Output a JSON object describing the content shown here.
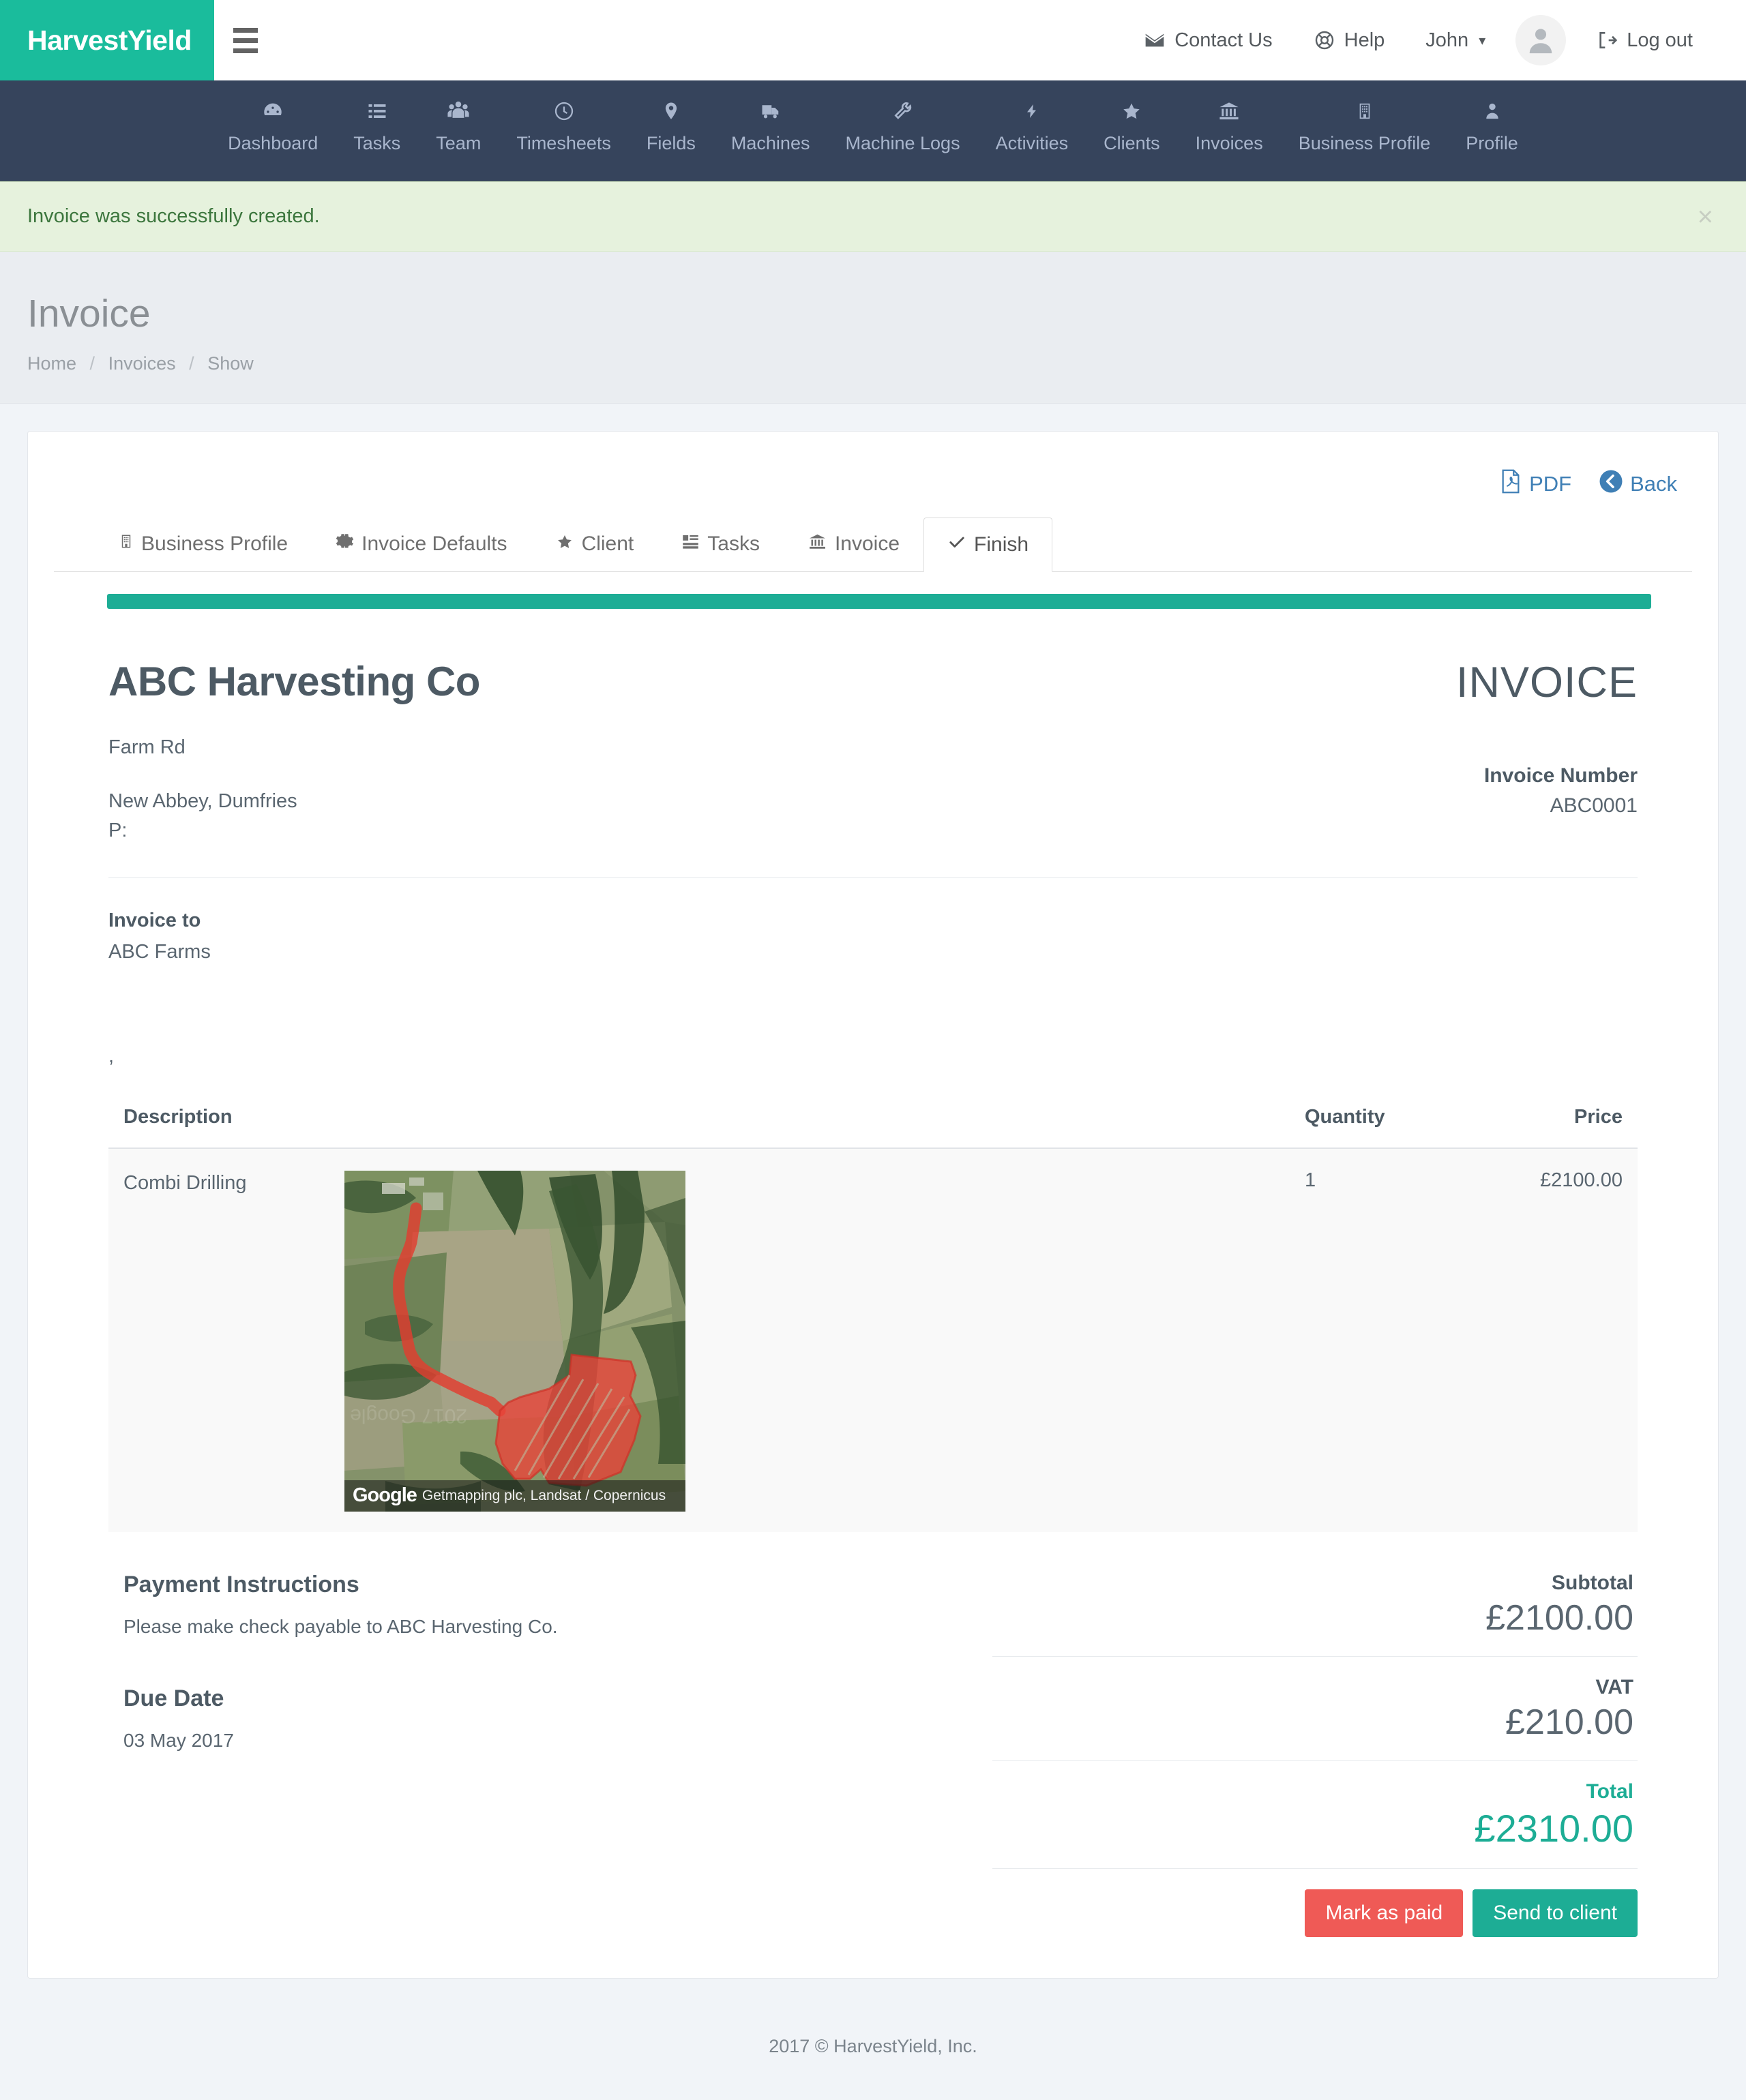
{
  "brand": {
    "name": "HarvestYield"
  },
  "topbar": {
    "contact": "Contact Us",
    "help": "Help",
    "user": "John",
    "logout": "Log out"
  },
  "nav": {
    "items": [
      {
        "label": "Dashboard",
        "icon": "dashboard-icon"
      },
      {
        "label": "Tasks",
        "icon": "list-icon"
      },
      {
        "label": "Team",
        "icon": "users-icon"
      },
      {
        "label": "Timesheets",
        "icon": "clock-icon"
      },
      {
        "label": "Fields",
        "icon": "map-pin-icon"
      },
      {
        "label": "Machines",
        "icon": "truck-icon"
      },
      {
        "label": "Machine Logs",
        "icon": "wrench-icon"
      },
      {
        "label": "Activities",
        "icon": "bolt-icon"
      },
      {
        "label": "Clients",
        "icon": "star-icon"
      },
      {
        "label": "Invoices",
        "icon": "bank-icon"
      },
      {
        "label": "Business Profile",
        "icon": "building-icon"
      },
      {
        "label": "Profile",
        "icon": "person-icon"
      }
    ]
  },
  "alert": {
    "message": "Invoice was successfully created.",
    "close": "×"
  },
  "page": {
    "title": "Invoice",
    "breadcrumb": [
      "Home",
      "Invoices",
      "Show"
    ]
  },
  "card_actions": {
    "pdf": "PDF",
    "back": "Back"
  },
  "tabs": [
    {
      "label": "Business Profile",
      "icon": "building-icon",
      "active": false
    },
    {
      "label": "Invoice Defaults",
      "icon": "gear-icon",
      "active": false
    },
    {
      "label": "Client",
      "icon": "star-icon",
      "active": false
    },
    {
      "label": "Tasks",
      "icon": "server-icon",
      "active": false
    },
    {
      "label": "Invoice",
      "icon": "bank-icon",
      "active": false
    },
    {
      "label": "Finish",
      "icon": "check-icon",
      "active": true
    }
  ],
  "invoice": {
    "business_name": "ABC Harvesting Co",
    "address_line1": "Farm Rd",
    "address_line2": "New Abbey, Dumfries",
    "phone": "P:",
    "heading": "INVOICE",
    "number_label": "Invoice Number",
    "number": "ABC0001",
    "invoice_to_label": "Invoice to",
    "invoice_to_name": "ABC Farms",
    "invoice_to_address": ",",
    "table": {
      "headers": {
        "description": "Description",
        "quantity": "Quantity",
        "price": "Price"
      },
      "rows": [
        {
          "description": "Combi Drilling",
          "quantity": "1",
          "price": "£2100.00",
          "has_map": true
        }
      ]
    },
    "map_attribution": {
      "logo": "Google",
      "text": "Getmapping plc, Landsat / Copernicus"
    },
    "payment_title": "Payment Instructions",
    "payment_text": "Please make check payable to ABC Harvesting Co.",
    "due_title": "Due Date",
    "due_date": "03 May 2017",
    "totals": [
      {
        "label": "Subtotal",
        "value": "£2100.00",
        "grand": false
      },
      {
        "label": "VAT",
        "value": "£210.00",
        "grand": false
      },
      {
        "label": "Total",
        "value": "£2310.00",
        "grand": true
      }
    ],
    "buttons": {
      "mark_paid": "Mark as paid",
      "send_client": "Send to client"
    }
  },
  "footer": {
    "text": "2017 © HarvestYield, Inc."
  },
  "colors": {
    "brand_green": "#1abc9c",
    "total_green": "#1dad95",
    "navy": "#36445c",
    "danger_red": "#ef5a56",
    "link_blue": "#3f7fb5",
    "alert_green_text": "#3c763d"
  }
}
